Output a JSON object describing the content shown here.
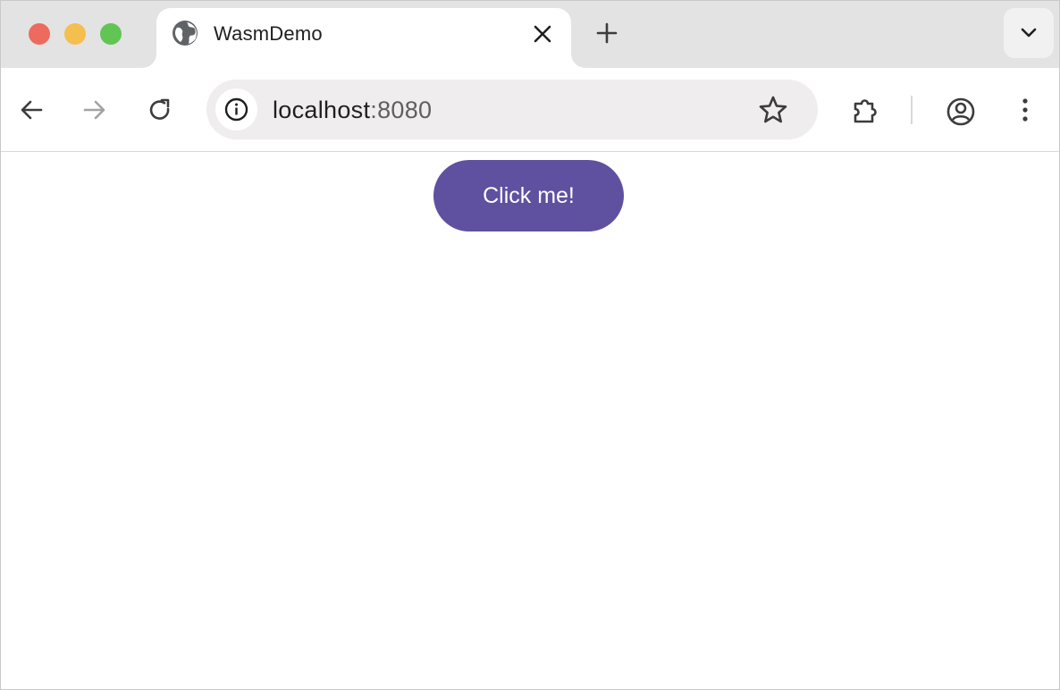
{
  "colors": {
    "traffic_close": "#ec6a5e",
    "traffic_minimize": "#f4bf4f",
    "traffic_maximize": "#61c554",
    "button_accent": "#6050a0",
    "tabstrip_bg": "#e3e3e3",
    "omnibox_bg": "#efeded"
  },
  "tab": {
    "title": "WasmDemo",
    "favicon": "globe-icon"
  },
  "toolbar": {
    "url_host": "localhost",
    "url_port": ":8080",
    "icons": [
      "back-arrow-icon",
      "forward-arrow-icon",
      "reload-icon",
      "info-icon",
      "star-icon",
      "puzzle-icon",
      "profile-icon",
      "more-vert-icon"
    ]
  },
  "page": {
    "button_label": "Click me!"
  }
}
